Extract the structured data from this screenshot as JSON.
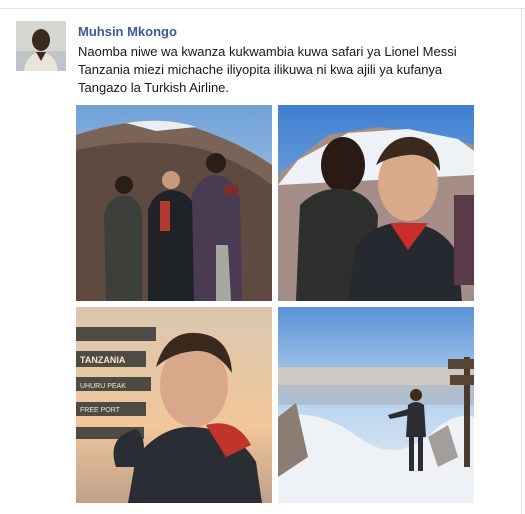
{
  "post": {
    "author": "Muhsin Mkongo",
    "message": "Naomba niwe wa kwanza kukwambia kuwa safari ya Lionel Messi Tanzania miezi michache iliyopita ilikuwa ni kwa ajili ya kufanya Tangazo la Turkish Airline.",
    "photos": [
      {
        "subject": "group-on-mountain-slope"
      },
      {
        "subject": "selfie-with-guide"
      },
      {
        "subject": "selfie-at-summit-signs"
      },
      {
        "subject": "standing-on-snowy-summit"
      }
    ],
    "sign_text": [
      "TANZANIA",
      "UHURU PEAK",
      "FREE PORT"
    ]
  },
  "colors": {
    "link": "#3b5998",
    "text": "#141823",
    "sky": "#8fb8e0",
    "snow": "#eef2f6"
  }
}
